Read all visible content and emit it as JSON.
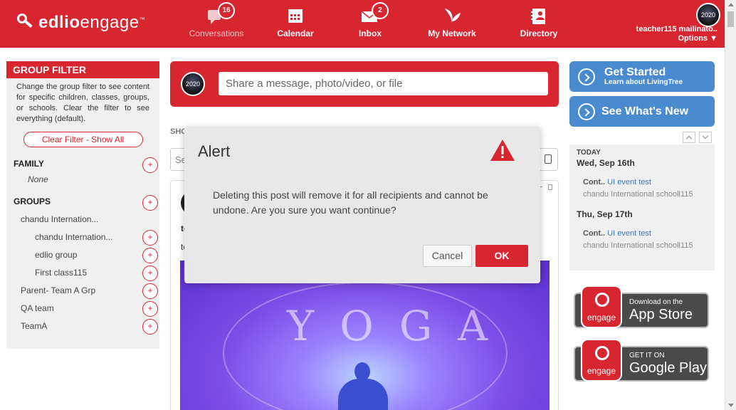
{
  "app": {
    "logo_bold": "edlio",
    "logo_light": "engage",
    "logo_tm": "™",
    "brand_color": "#d7262f",
    "accent_blue": "#4a8bd0"
  },
  "nav": [
    {
      "label": "Conversations",
      "icon": "chat-bubble-icon",
      "badge": "16"
    },
    {
      "label": "Calendar",
      "icon": "calendar-icon",
      "badge": ""
    },
    {
      "label": "Inbox",
      "icon": "envelope-icon",
      "badge": "2"
    },
    {
      "label": "My Network",
      "icon": "leaf-icon",
      "badge": ""
    },
    {
      "label": "Directory",
      "icon": "address-book-icon",
      "badge": ""
    }
  ],
  "user": {
    "name": "teacher115 mailinato..",
    "options": "Options ▼",
    "avatar_text": "2020"
  },
  "filter": {
    "title": "GROUP FILTER",
    "description": "Change the group filter to see content for specific children, classes, groups, or schools. Clear the filter to see everything (default).",
    "clear_label": "Clear Filter - Show All",
    "family_title": "FAMILY",
    "family_none": "None",
    "groups_title": "GROUPS",
    "groups": [
      "chandu Internation...",
      "chandu Internation...",
      "edlio group",
      "First class115",
      "Parent- Team A Grp",
      "QA team",
      "TeamA"
    ],
    "plus": "+"
  },
  "share": {
    "placeholder": "Share a message, photo/video, or file",
    "avatar_text": "2020"
  },
  "feed": {
    "show_label": "SHO",
    "search_placeholder": "Se",
    "post_name": "te",
    "post_text": "te",
    "image_word": "YOGA"
  },
  "cta": {
    "get_started": "Get Started",
    "get_started_sub": "Learn about LivingTree",
    "whats_new": "See What's New"
  },
  "events": {
    "today": "TODAY",
    "days": [
      {
        "date": "Wed, Sep 16th",
        "prefix": "Cont..",
        "title": "UI event test",
        "school": "chandu International schooll115"
      },
      {
        "date": "Thu, Sep 17th",
        "prefix": "Cont..",
        "title": "UI event test",
        "school": "chandu International schooll115"
      }
    ]
  },
  "stores": {
    "app_label": "engage",
    "apple_line1": "Download on the",
    "apple_line2": "App Store",
    "google_line1": "GET IT ON",
    "google_line2": "Google Play"
  },
  "modal": {
    "title": "Alert",
    "message": "Deleting this post will remove it for all recipients and cannot be undone. Are you sure you want continue?",
    "cancel": "Cancel",
    "ok": "OK",
    "icon": "warning-triangle-icon"
  }
}
